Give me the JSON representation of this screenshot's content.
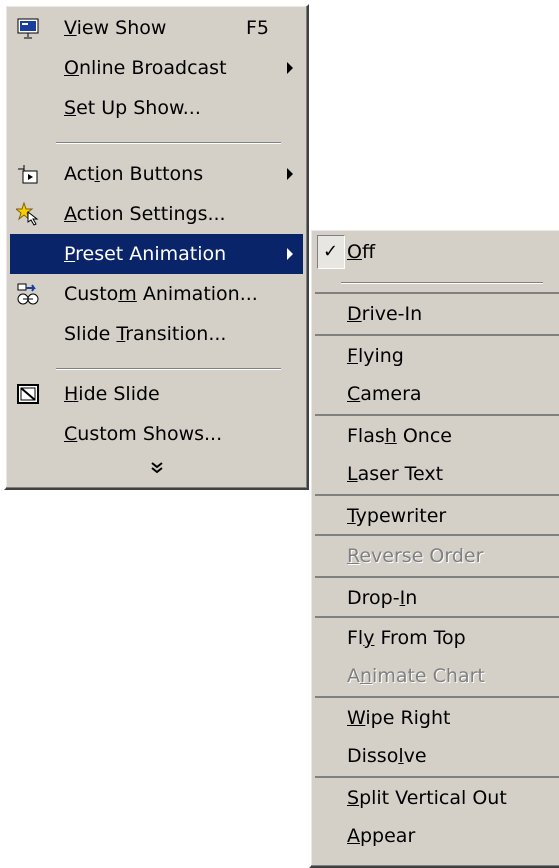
{
  "main_menu": {
    "items": [
      {
        "pre": "",
        "ul": "V",
        "post": "iew Show",
        "shortcut": "F5",
        "icon": "view-show-icon"
      },
      {
        "pre": "",
        "ul": "O",
        "post": "nline Broadcast",
        "submenu": true
      },
      {
        "pre": "",
        "ul": "S",
        "post": "et Up Show..."
      },
      {
        "pre": "Act",
        "ul": "i",
        "post": "on Buttons",
        "submenu": true,
        "icon": "action-buttons-icon"
      },
      {
        "pre": "",
        "ul": "A",
        "post": "ction Settings...",
        "icon": "action-settings-icon"
      },
      {
        "pre": "",
        "ul": "P",
        "post": "reset Animation",
        "submenu": true,
        "highlighted": true
      },
      {
        "pre": "Custo",
        "ul": "m",
        "post": " Animation...",
        "icon": "custom-animation-icon"
      },
      {
        "pre": "Slide ",
        "ul": "T",
        "post": "ransition..."
      },
      {
        "pre": "",
        "ul": "H",
        "post": "ide Slide",
        "icon": "hide-slide-icon"
      },
      {
        "pre": "",
        "ul": "C",
        "post": "ustom Shows..."
      }
    ],
    "expand_glyph": "»"
  },
  "preset_submenu": {
    "items": [
      {
        "pre": "",
        "ul": "O",
        "post": "ff",
        "checked": true
      },
      {
        "pre": "",
        "ul": "D",
        "post": "rive-In"
      },
      {
        "pre": "",
        "ul": "F",
        "post": "lying"
      },
      {
        "pre": "",
        "ul": "C",
        "post": "amera"
      },
      {
        "pre": "Flas",
        "ul": "h",
        "post": " Once"
      },
      {
        "pre": "",
        "ul": "L",
        "post": "aser Text"
      },
      {
        "pre": "",
        "ul": "T",
        "post": "ypewriter"
      },
      {
        "pre": "",
        "ul": "R",
        "post": "everse Order",
        "disabled": true
      },
      {
        "pre": "Drop-",
        "ul": "I",
        "post": "n"
      },
      {
        "pre": "Fl",
        "ul": "y",
        "post": " From Top"
      },
      {
        "pre": "A",
        "ul": "n",
        "post": "imate Chart",
        "disabled": true
      },
      {
        "pre": "",
        "ul": "W",
        "post": "ipe Right"
      },
      {
        "pre": "Disso",
        "ul": "l",
        "post": "ve"
      },
      {
        "pre": "",
        "ul": "S",
        "post": "plit Vertical Out"
      },
      {
        "pre": "",
        "ul": "A",
        "post": "ppear"
      }
    ],
    "check_glyph": "✓"
  },
  "colors": {
    "menu_bg": "#d4d0c8",
    "highlight": "#0a246a",
    "disabled": "#808080"
  }
}
